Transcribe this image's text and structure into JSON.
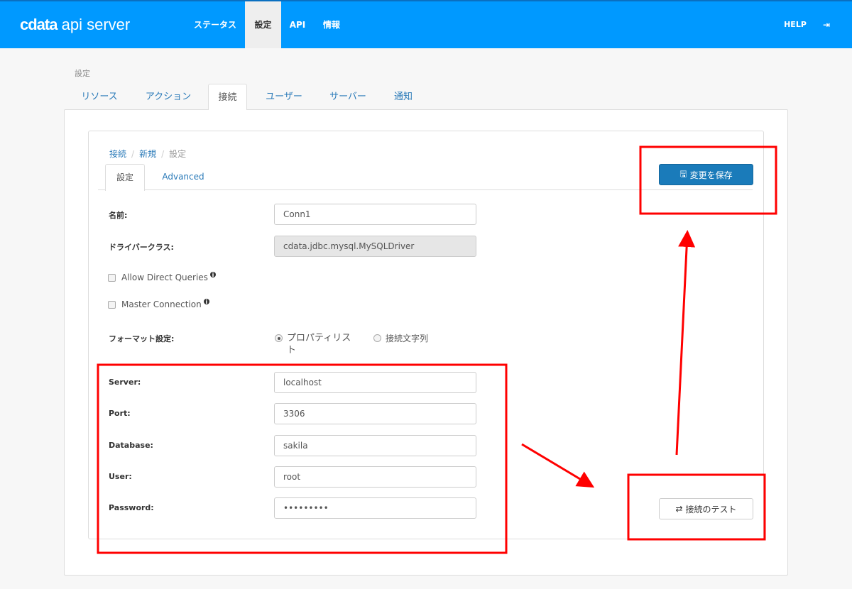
{
  "header": {
    "logo_brand": "cdata",
    "logo_product": "api server",
    "nav": [
      "ステータス",
      "設定",
      "API",
      "情報"
    ],
    "help": "HELP"
  },
  "page": {
    "title": "設定",
    "tabs": [
      "リソース",
      "アクション",
      "接続",
      "ユーザー",
      "サーバー",
      "通知"
    ]
  },
  "breadcrumb": [
    "接続",
    "新規",
    "設定"
  ],
  "subtabs": [
    "設定",
    "Advanced"
  ],
  "form": {
    "name_label": "名前:",
    "name_value": "Conn1",
    "driver_label": "ドライバークラス:",
    "driver_value": "cdata.jdbc.mysql.MySQLDriver",
    "allow_direct": "Allow Direct Queries",
    "master_conn": "Master Connection",
    "format_label": "フォーマット設定:",
    "format_opt1": "プロパティリスト",
    "format_opt2": "接続文字列",
    "server_label": "Server:",
    "server_value": "localhost",
    "port_label": "Port:",
    "port_value": "3306",
    "db_label": "Database:",
    "db_value": "sakila",
    "user_label": "User:",
    "user_value": "root",
    "pw_label": "Password:",
    "pw_value": "•••••••••"
  },
  "buttons": {
    "save": "変更を保存",
    "test": "接続のテスト"
  },
  "colors": {
    "header": "#0099ff",
    "primary": "#1a7bba",
    "annotation": "#ff0000"
  }
}
